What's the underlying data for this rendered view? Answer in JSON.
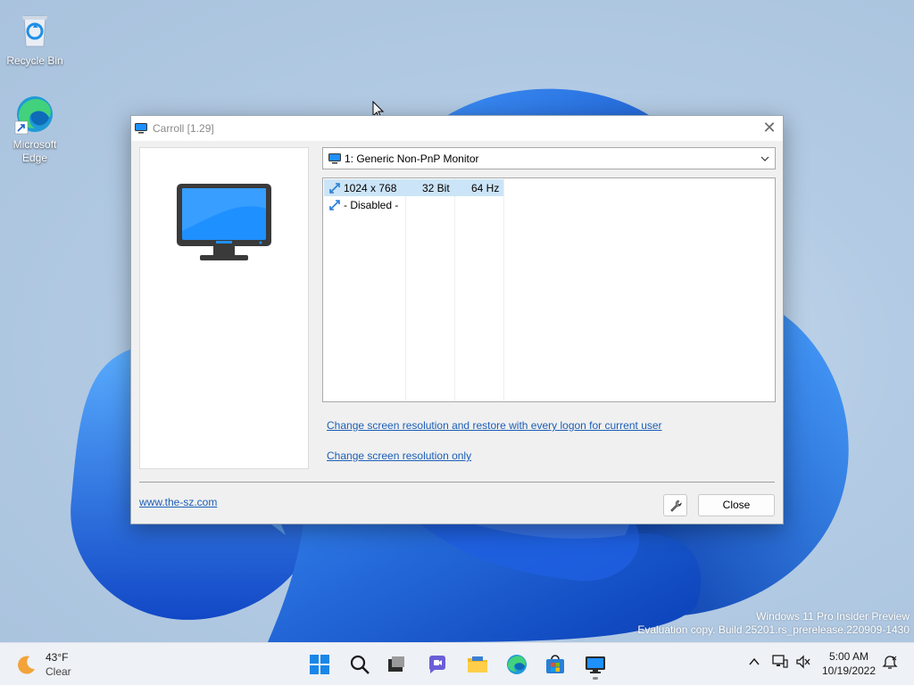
{
  "desktop": {
    "icons": [
      {
        "label": "Recycle Bin"
      },
      {
        "label": "Microsoft Edge"
      }
    ],
    "watermark": {
      "line1": "Windows 11 Pro Insider Preview",
      "line2": "Evaluation copy. Build 25201.rs_prerelease.220909-1430"
    }
  },
  "window": {
    "title": "Carroll [1.29]",
    "close_glyph": "✕",
    "monitor_select": {
      "value": "1: Generic Non-PnP Monitor",
      "icon": "monitor-icon"
    },
    "modes": [
      {
        "resolution": "1024 x 768",
        "depth": "32 Bit",
        "refresh": "64 Hz",
        "selected": true
      },
      {
        "resolution": "- Disabled -",
        "depth": "",
        "refresh": "",
        "selected": false
      }
    ],
    "links": {
      "restore": "Change screen resolution and restore with every logon for current user",
      "only": "Change screen resolution only"
    },
    "website": "www.the-sz.com",
    "close_button": "Close"
  },
  "taskbar": {
    "weather": {
      "temp": "43°F",
      "condition": "Clear"
    },
    "apps": [
      "start-icon",
      "search-icon",
      "task-view-icon",
      "chat-icon",
      "file-explorer-icon",
      "edge-icon",
      "store-icon",
      "carroll-monitor-icon"
    ],
    "clock": {
      "time": "5:00 AM",
      "date": "10/19/2022"
    }
  },
  "colors": {
    "accent": "#0a64d8",
    "link": "#1c5fb8",
    "selection": "#cce4f7",
    "monitor_screen": "#1e90ff"
  }
}
